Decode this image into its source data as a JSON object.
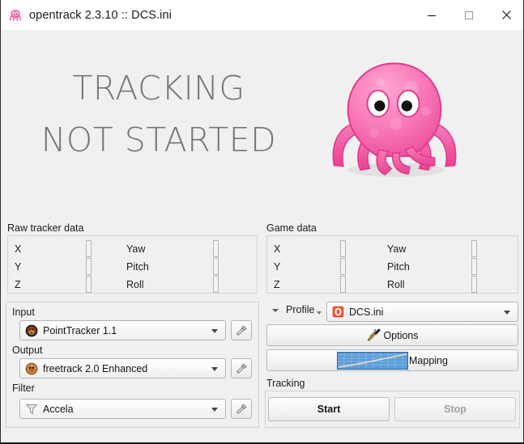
{
  "window": {
    "title": "opentrack 2.3.10 :: DCS.ini",
    "app_icon": "octopus-icon",
    "minimize_label": "—",
    "maximize_label": "□",
    "close_label": "✕"
  },
  "hero": {
    "status_line1": "TRACKING",
    "status_line2": "NOT STARTED",
    "logo": "octopus-logo"
  },
  "raw_tracker_data": {
    "group_label": "Raw tracker data",
    "rows": [
      {
        "left_label": "X",
        "left_value": "",
        "right_label": "Yaw",
        "right_value": ""
      },
      {
        "left_label": "Y",
        "left_value": "",
        "right_label": "Pitch",
        "right_value": ""
      },
      {
        "left_label": "Z",
        "left_value": "",
        "right_label": "Roll",
        "right_value": ""
      }
    ]
  },
  "game_data": {
    "group_label": "Game data",
    "rows": [
      {
        "left_label": "X",
        "left_value": "",
        "right_label": "Yaw",
        "right_value": ""
      },
      {
        "left_label": "Y",
        "left_value": "",
        "right_label": "Pitch",
        "right_value": ""
      },
      {
        "left_label": "Z",
        "left_value": "",
        "right_label": "Roll",
        "right_value": ""
      }
    ]
  },
  "modules": {
    "input_label": "Input",
    "input_value": "PointTracker 1.1",
    "input_icon": "pointtracker-icon",
    "output_label": "Output",
    "output_value": "freetrack 2.0 Enhanced",
    "output_icon": "freetrack-icon",
    "filter_label": "Filter",
    "filter_value": "Accela",
    "filter_icon": "funnel-icon",
    "config_button_icon": "hammer-icon"
  },
  "profile": {
    "label": "Profile",
    "value": "DCS.ini",
    "icon": "opentrack-profile-icon"
  },
  "actions": {
    "options_label": "Options",
    "options_icon": "hammer-wrench-icon",
    "mapping_label": "Mapping",
    "mapping_icon": "curve-graph-icon"
  },
  "tracking": {
    "group_label": "Tracking",
    "start_label": "Start",
    "stop_label": "Stop",
    "stop_disabled": true
  },
  "colors": {
    "window_bg": "#f0f0f0",
    "titlebar_bg": "#ffffff",
    "status_text": "#767676",
    "octopus_pink": "#f museum"
  }
}
